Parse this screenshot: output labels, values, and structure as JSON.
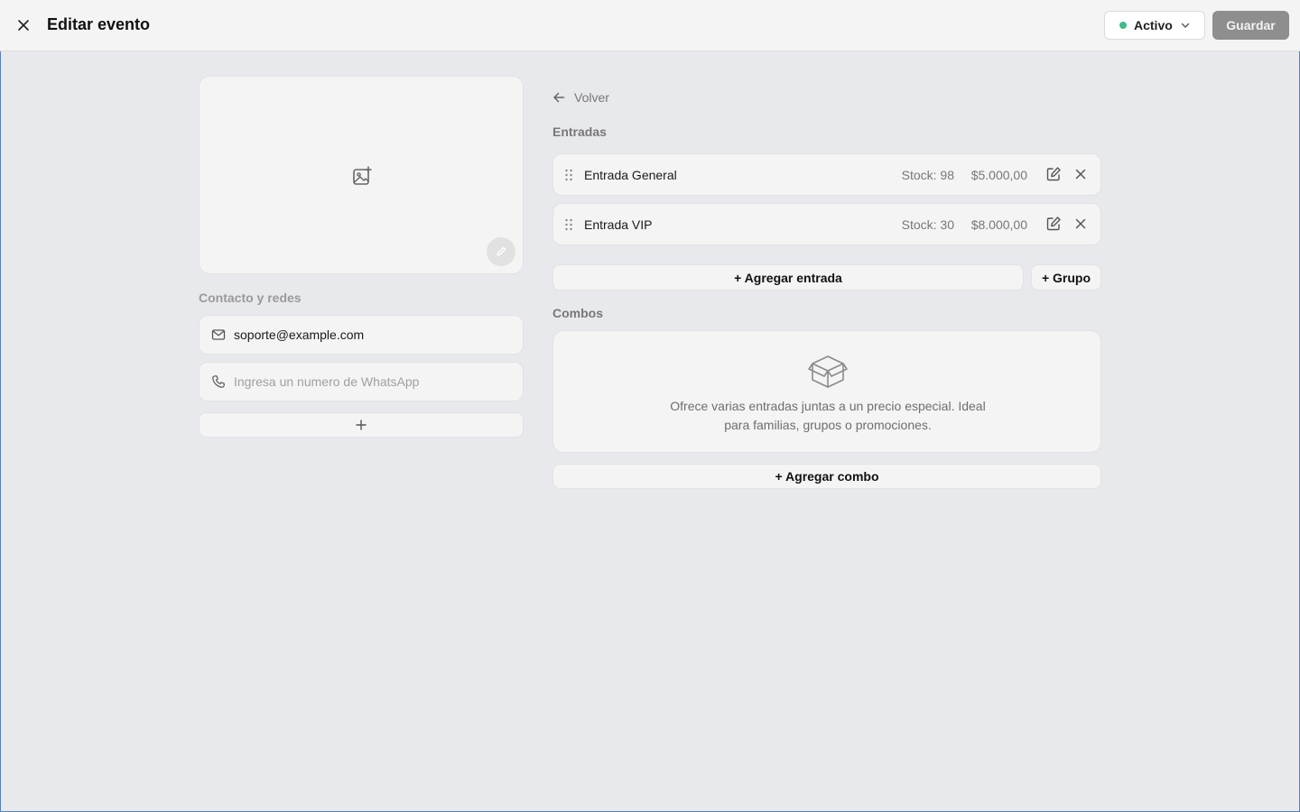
{
  "header": {
    "title": "Editar evento",
    "status": {
      "label": "Activo",
      "color": "#3dbb8a"
    },
    "save_label": "Guardar"
  },
  "left": {
    "contact_section_label": "Contacto y redes",
    "email": {
      "value": "soporte@example.com"
    },
    "whatsapp": {
      "placeholder": "Ingresa un numero de WhatsApp"
    },
    "add_icon": "plus-icon"
  },
  "right": {
    "back_label": "Volver",
    "tickets_section_label": "Entradas",
    "tickets": [
      {
        "name": "Entrada General",
        "stock": "Stock: 98",
        "price": "$5.000,00"
      },
      {
        "name": "Entrada VIP",
        "stock": "Stock: 30",
        "price": "$8.000,00"
      }
    ],
    "add_ticket_label": "+ Agregar entrada",
    "add_group_label": "+ Grupo",
    "combos_section_label": "Combos",
    "combos_empty_line1": "Ofrece varias entradas juntas a un precio especial. Ideal",
    "combos_empty_line2": "para familias, grupos o promociones.",
    "add_combo_label": "+ Agregar combo"
  }
}
